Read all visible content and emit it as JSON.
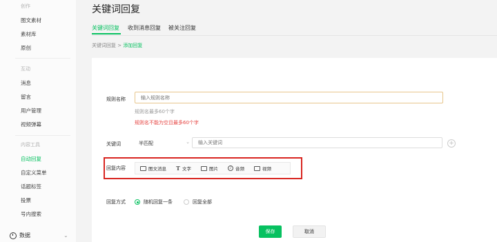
{
  "sidebar": {
    "groups": [
      {
        "title": "创作",
        "items": [
          "图文素材",
          "素材库",
          "原创"
        ]
      },
      {
        "title": "互动",
        "items": [
          "消息",
          "留言",
          "用户管理",
          "视频弹幕"
        ]
      },
      {
        "title": "内容工具",
        "items": [
          "自动回复",
          "自定义菜单",
          "话题标签",
          "投票",
          "号内搜索"
        ]
      }
    ],
    "active_item": "自动回复",
    "bottom_item": "数据"
  },
  "header": {
    "title": "关键词回复",
    "tabs": [
      "关键词回复",
      "收到消息回复",
      "被关注回复"
    ],
    "active_tab": 0
  },
  "breadcrumb": {
    "parent": "关键词回复",
    "separator": ">",
    "current": "添加回复"
  },
  "form": {
    "rule_name": {
      "label": "规则名称",
      "placeholder": "输入规则名称",
      "hint": "规则名最多60个字",
      "error": "规则名不能为空且最多60个字"
    },
    "keyword": {
      "label": "关键词",
      "match_mode": "半匹配",
      "placeholder": "输入关键词",
      "add_icon": "plus-circle-icon"
    },
    "reply_content": {
      "label": "回复内容",
      "types": [
        {
          "label": "图文消息",
          "icon": "image-text-icon"
        },
        {
          "label": "文字",
          "icon": "text-icon"
        },
        {
          "label": "图片",
          "icon": "image-icon"
        },
        {
          "label": "音频",
          "icon": "audio-icon"
        },
        {
          "label": "视频",
          "icon": "video-icon"
        }
      ]
    },
    "reply_mode": {
      "label": "回复方式",
      "options": [
        "随机回复一条",
        "回复全部"
      ],
      "selected": 0
    },
    "buttons": {
      "save": "保存",
      "cancel": "取消"
    }
  },
  "colors": {
    "accent": "#07c160",
    "error": "#e64340",
    "highlight_box": "#d8241f"
  }
}
